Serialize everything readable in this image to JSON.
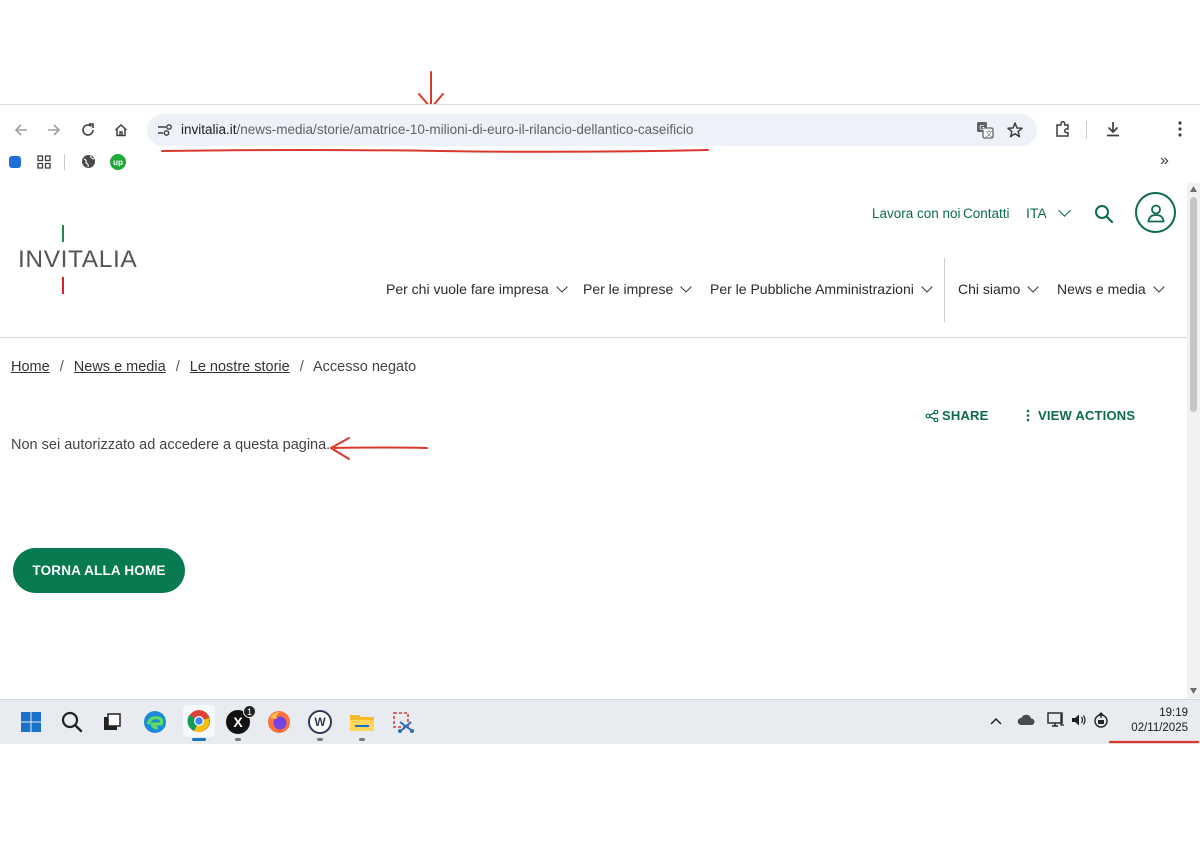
{
  "browser": {
    "url_domain": "invitalia.it",
    "url_path": "/news-media/storie/amatrice-10-milioni-di-euro-il-rilancio-dellantico-caseificio",
    "overflow_label": "»"
  },
  "header": {
    "logo_text": "INVITALIA",
    "top_links": [
      "Lavora con noi",
      "Contatti"
    ],
    "language": "ITA",
    "main_nav": [
      "Per chi vuole fare impresa",
      "Per le imprese",
      "Per le Pubbliche Amministrazioni",
      "Chi siamo",
      "News e media"
    ]
  },
  "breadcrumb": {
    "items": [
      "Home",
      "News e media",
      "Le nostre storie"
    ],
    "current": "Accesso negato",
    "separator": "/"
  },
  "actions": {
    "share_label": "SHARE",
    "view_actions_label": "VIEW ACTIONS"
  },
  "message": "Non sei autorizzato ad accedere a questa pagina.",
  "home_button_label": "TORNA ALLA HOME",
  "taskbar": {
    "x_badge": "1",
    "time": "19:19",
    "date": "02/11/2025"
  },
  "colors": {
    "brand_green": "#0c6c4a",
    "button_green": "#087a50",
    "annotation_red": "#d9382c"
  }
}
